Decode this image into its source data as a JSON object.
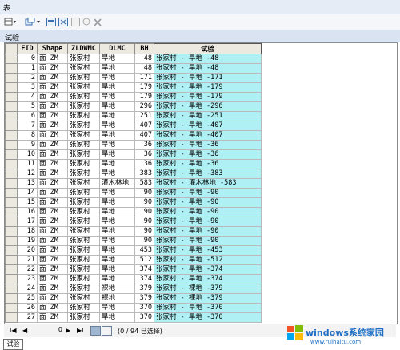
{
  "window": {
    "title": "表"
  },
  "tab": {
    "label": "试验"
  },
  "table": {
    "columns": [
      "",
      "FID",
      "Shape",
      "ZLDWMC",
      "DLMC",
      "BH",
      "试验"
    ],
    "rows": [
      [
        "0",
        "面 ZM",
        "张家村",
        "旱地",
        "48",
        "张家村 - 旱地 -48"
      ],
      [
        "1",
        "面 ZM",
        "张家村",
        "旱地",
        "48",
        "张家村 - 旱地 -48"
      ],
      [
        "2",
        "面 ZM",
        "张家村",
        "旱地",
        "171",
        "张家村 - 旱地 -171"
      ],
      [
        "3",
        "面 ZM",
        "张家村",
        "旱地",
        "179",
        "张家村 - 旱地 -179"
      ],
      [
        "4",
        "面 ZM",
        "张家村",
        "旱地",
        "179",
        "张家村 - 旱地 -179"
      ],
      [
        "5",
        "面 ZM",
        "张家村",
        "旱地",
        "296",
        "张家村 - 旱地 -296"
      ],
      [
        "6",
        "面 ZM",
        "张家村",
        "旱地",
        "251",
        "张家村 - 旱地 -251"
      ],
      [
        "7",
        "面 ZM",
        "张家村",
        "旱地",
        "407",
        "张家村 - 旱地 -407"
      ],
      [
        "8",
        "面 ZM",
        "张家村",
        "旱地",
        "407",
        "张家村 - 旱地 -407"
      ],
      [
        "9",
        "面 ZM",
        "张家村",
        "旱地",
        "36",
        "张家村 - 旱地 -36"
      ],
      [
        "10",
        "面 ZM",
        "张家村",
        "旱地",
        "36",
        "张家村 - 旱地 -36"
      ],
      [
        "11",
        "面 ZM",
        "张家村",
        "旱地",
        "36",
        "张家村 - 旱地 -36"
      ],
      [
        "12",
        "面 ZM",
        "张家村",
        "旱地",
        "383",
        "张家村 - 旱地 -383"
      ],
      [
        "13",
        "面 ZM",
        "张家村",
        "灌木林地",
        "583",
        "张家村 - 灌木林地 -583"
      ],
      [
        "14",
        "面 ZM",
        "张家村",
        "旱地",
        "90",
        "张家村 - 旱地 -90"
      ],
      [
        "15",
        "面 ZM",
        "张家村",
        "旱地",
        "90",
        "张家村 - 旱地 -90"
      ],
      [
        "16",
        "面 ZM",
        "张家村",
        "旱地",
        "90",
        "张家村 - 旱地 -90"
      ],
      [
        "17",
        "面 ZM",
        "张家村",
        "旱地",
        "90",
        "张家村 - 旱地 -90"
      ],
      [
        "18",
        "面 ZM",
        "张家村",
        "旱地",
        "90",
        "张家村 - 旱地 -90"
      ],
      [
        "19",
        "面 ZM",
        "张家村",
        "旱地",
        "90",
        "张家村 - 旱地 -90"
      ],
      [
        "20",
        "面 ZM",
        "张家村",
        "旱地",
        "453",
        "张家村 - 旱地 -453"
      ],
      [
        "21",
        "面 ZM",
        "张家村",
        "旱地",
        "512",
        "张家村 - 旱地 -512"
      ],
      [
        "22",
        "面 ZM",
        "张家村",
        "旱地",
        "374",
        "张家村 - 旱地 -374"
      ],
      [
        "23",
        "面 ZM",
        "张家村",
        "旱地",
        "374",
        "张家村 - 旱地 -374"
      ],
      [
        "24",
        "面 ZM",
        "张家村",
        "裸地",
        "379",
        "张家村 - 裸地 -379"
      ],
      [
        "25",
        "面 ZM",
        "张家村",
        "裸地",
        "379",
        "张家村 - 裸地 -379"
      ],
      [
        "26",
        "面 ZM",
        "张家村",
        "旱地",
        "370",
        "张家村 - 旱地 -370"
      ],
      [
        "27",
        "面 ZM",
        "张家村",
        "旱地",
        "370",
        "张家村 - 旱地 -370"
      ]
    ]
  },
  "status": {
    "record_value": "0",
    "status_text": "(0 / 94 已选择)",
    "nav_first": "I◀",
    "nav_prev": "◀",
    "nav_next": "▶",
    "nav_last": "▶I"
  },
  "bottom_tab": {
    "label": "试验"
  },
  "watermark": {
    "brand": "windows系统家园",
    "url": "www.ruihaitu.com"
  },
  "colors": {
    "trial_column": "#aef0f3",
    "header": "#ece9e0",
    "title_bar": "#e6ecf5"
  }
}
